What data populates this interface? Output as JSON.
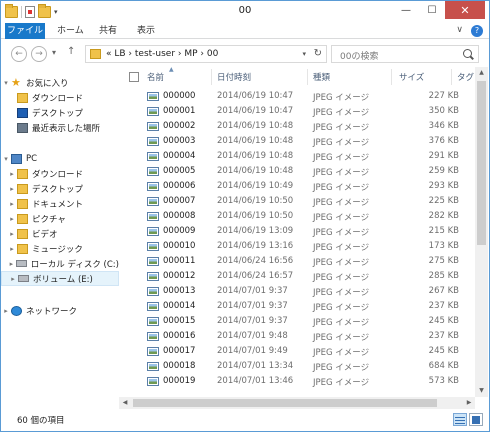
{
  "window": {
    "title": "00",
    "minimize": "—",
    "maximize": "☐",
    "close": "✕"
  },
  "ribbon": {
    "tabs": [
      "ファイル",
      "ホーム",
      "共有",
      "表示"
    ],
    "expand": "∨",
    "help": "?"
  },
  "nav": {
    "back": "←",
    "forward": "→",
    "recent": "▾",
    "up": "↑",
    "address": "« LB › test-user › MP › 00",
    "address_dropdown": "▾",
    "refresh": "↻",
    "search_placeholder": "00の検索"
  },
  "navpane": {
    "favorites": {
      "label": "お気に入り",
      "items": [
        "ダウンロード",
        "デスクトップ",
        "最近表示した場所"
      ]
    },
    "pc": {
      "label": "PC",
      "items": [
        "ダウンロード",
        "デスクトップ",
        "ドキュメント",
        "ピクチャ",
        "ビデオ",
        "ミュージック",
        "ローカル ディスク (C:)",
        "ボリューム (E:)"
      ]
    },
    "network": {
      "label": "ネットワーク"
    }
  },
  "columns": {
    "name": "名前",
    "date": "日付時刻",
    "type": "種類",
    "size": "サイズ",
    "tag": "タグ"
  },
  "files": [
    {
      "name": "000000",
      "date": "2014/06/19 10:47",
      "type": "JPEG イメージ",
      "size": "227 KB"
    },
    {
      "name": "000001",
      "date": "2014/06/19 10:47",
      "type": "JPEG イメージ",
      "size": "350 KB"
    },
    {
      "name": "000002",
      "date": "2014/06/19 10:48",
      "type": "JPEG イメージ",
      "size": "346 KB"
    },
    {
      "name": "000003",
      "date": "2014/06/19 10:48",
      "type": "JPEG イメージ",
      "size": "376 KB"
    },
    {
      "name": "000004",
      "date": "2014/06/19 10:48",
      "type": "JPEG イメージ",
      "size": "291 KB"
    },
    {
      "name": "000005",
      "date": "2014/06/19 10:48",
      "type": "JPEG イメージ",
      "size": "259 KB"
    },
    {
      "name": "000006",
      "date": "2014/06/19 10:49",
      "type": "JPEG イメージ",
      "size": "293 KB"
    },
    {
      "name": "000007",
      "date": "2014/06/19 10:50",
      "type": "JPEG イメージ",
      "size": "225 KB"
    },
    {
      "name": "000008",
      "date": "2014/06/19 10:50",
      "type": "JPEG イメージ",
      "size": "282 KB"
    },
    {
      "name": "000009",
      "date": "2014/06/19 13:09",
      "type": "JPEG イメージ",
      "size": "215 KB"
    },
    {
      "name": "000010",
      "date": "2014/06/19 13:16",
      "type": "JPEG イメージ",
      "size": "173 KB"
    },
    {
      "name": "000011",
      "date": "2014/06/24 16:56",
      "type": "JPEG イメージ",
      "size": "275 KB"
    },
    {
      "name": "000012",
      "date": "2014/06/24 16:57",
      "type": "JPEG イメージ",
      "size": "285 KB"
    },
    {
      "name": "000013",
      "date": "2014/07/01 9:37",
      "type": "JPEG イメージ",
      "size": "267 KB"
    },
    {
      "name": "000014",
      "date": "2014/07/01 9:37",
      "type": "JPEG イメージ",
      "size": "237 KB"
    },
    {
      "name": "000015",
      "date": "2014/07/01 9:37",
      "type": "JPEG イメージ",
      "size": "245 KB"
    },
    {
      "name": "000016",
      "date": "2014/07/01 9:48",
      "type": "JPEG イメージ",
      "size": "237 KB"
    },
    {
      "name": "000017",
      "date": "2014/07/01 9:49",
      "type": "JPEG イメージ",
      "size": "245 KB"
    },
    {
      "name": "000018",
      "date": "2014/07/01 13:34",
      "type": "JPEG イメージ",
      "size": "684 KB"
    },
    {
      "name": "000019",
      "date": "2014/07/01 13:46",
      "type": "JPEG イメージ",
      "size": "573 KB"
    }
  ],
  "status": {
    "count": "60 個の項目"
  },
  "colors": {
    "accent": "#1979ca",
    "close": "#c7504b",
    "selection": "#e5f3fb"
  }
}
